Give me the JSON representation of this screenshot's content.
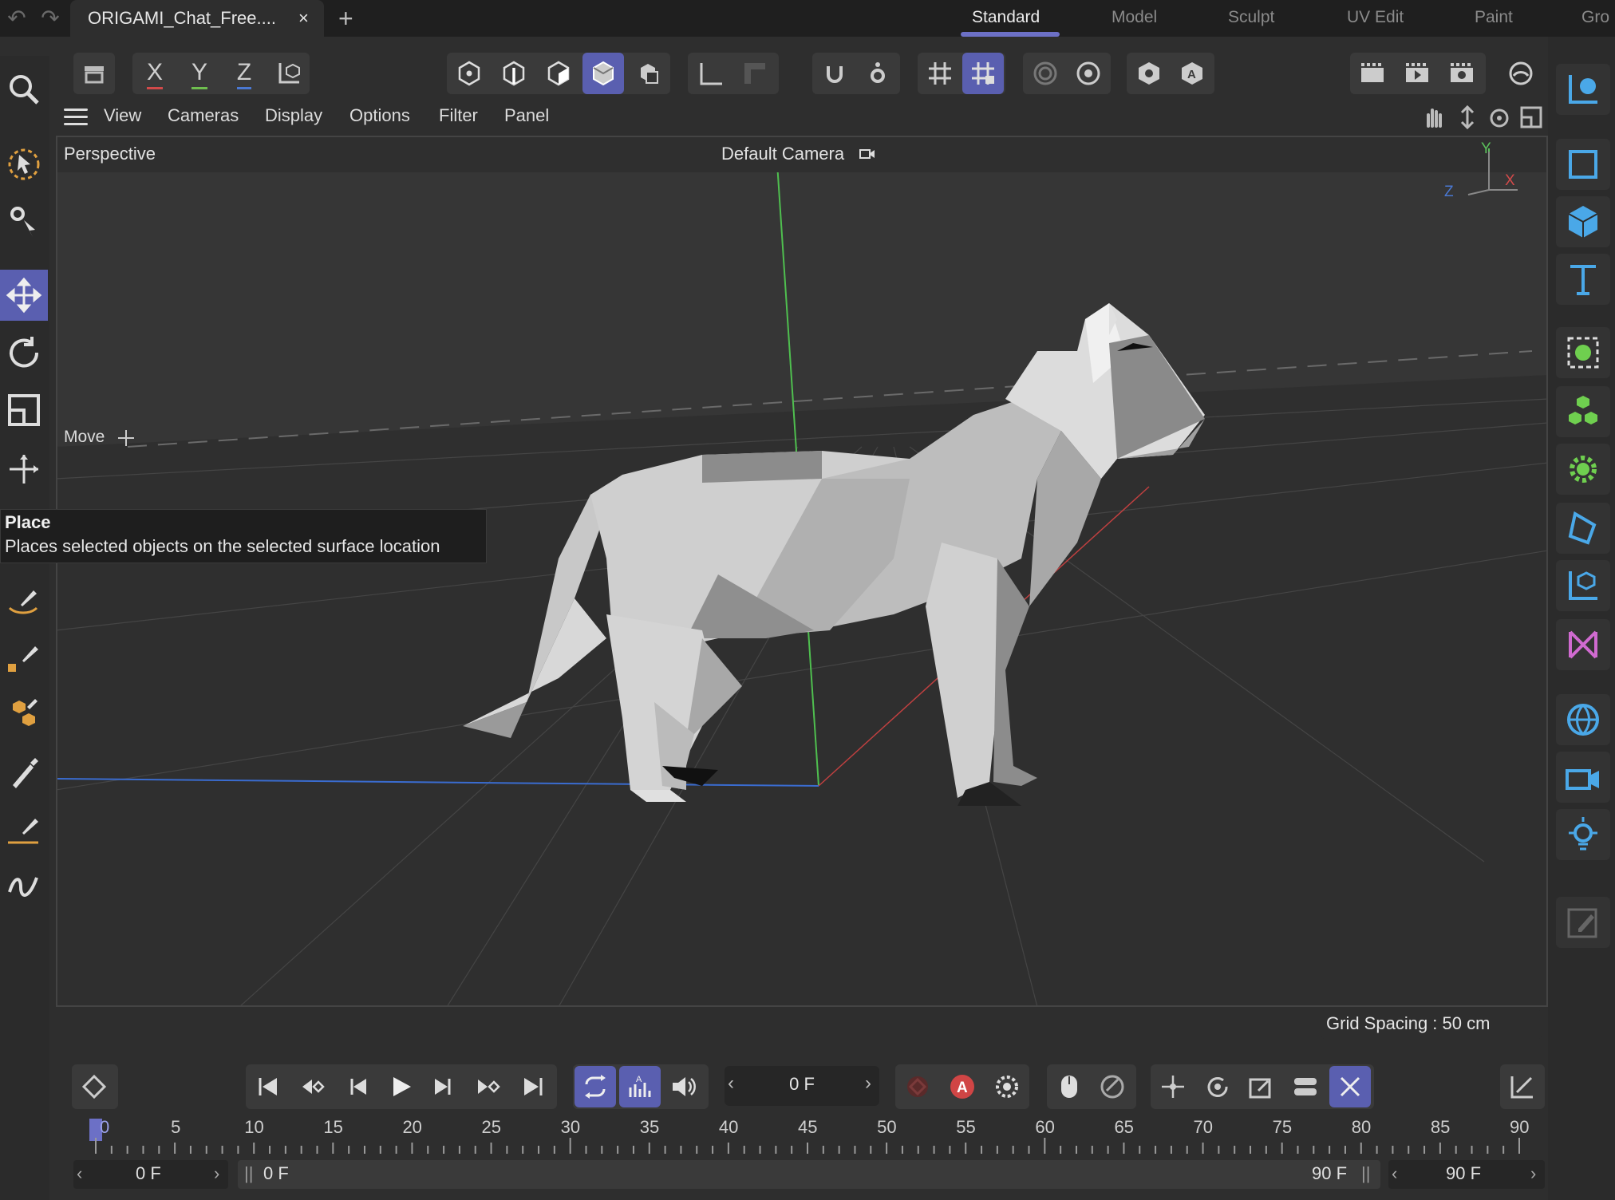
{
  "window": {
    "tab_title": "ORIGAMI_Chat_Free....",
    "tab_close": "×",
    "tab_add": "+",
    "undo_icon": "undo-icon",
    "redo_icon": "redo-icon"
  },
  "layouts": {
    "items": [
      "Standard",
      "Model",
      "Sculpt",
      "UV Edit",
      "Paint",
      "Gro"
    ],
    "active": "Standard",
    "accent": "#6c70c6"
  },
  "toolbar": {
    "axes": [
      "X",
      "Y",
      "Z"
    ],
    "axis_colors": [
      "#d24a4a",
      "#6fbf4f",
      "#4a78d2"
    ]
  },
  "viewport_menu": {
    "items": [
      "View",
      "Cameras",
      "Display",
      "Options",
      "Filter",
      "Panel"
    ]
  },
  "viewport": {
    "view_name": "Perspective",
    "camera": "Default Camera",
    "active_tool": "Move",
    "grid_spacing": "Grid Spacing : 50 cm",
    "axis_gizmo": {
      "y": "Y",
      "x": "X",
      "z": "Z"
    },
    "object": "low-poly cat model"
  },
  "tooltip": {
    "title": "Place",
    "description": "Places selected objects on the selected surface location"
  },
  "timeline": {
    "current_frame": "0 F",
    "ruler_ticks": [
      "0",
      "5",
      "10",
      "15",
      "20",
      "25",
      "30",
      "35",
      "40",
      "45",
      "50",
      "55",
      "60",
      "65",
      "70",
      "75",
      "80",
      "85",
      "90"
    ],
    "range_start": "0 F",
    "range_in": "0 F",
    "range_out": "90 F",
    "range_end": "90 F",
    "record_label": "A",
    "record_color": "#d04545"
  },
  "colors": {
    "highlight": "#5a5fb0",
    "background": "#2e2e2e",
    "viewport": "#363636"
  }
}
